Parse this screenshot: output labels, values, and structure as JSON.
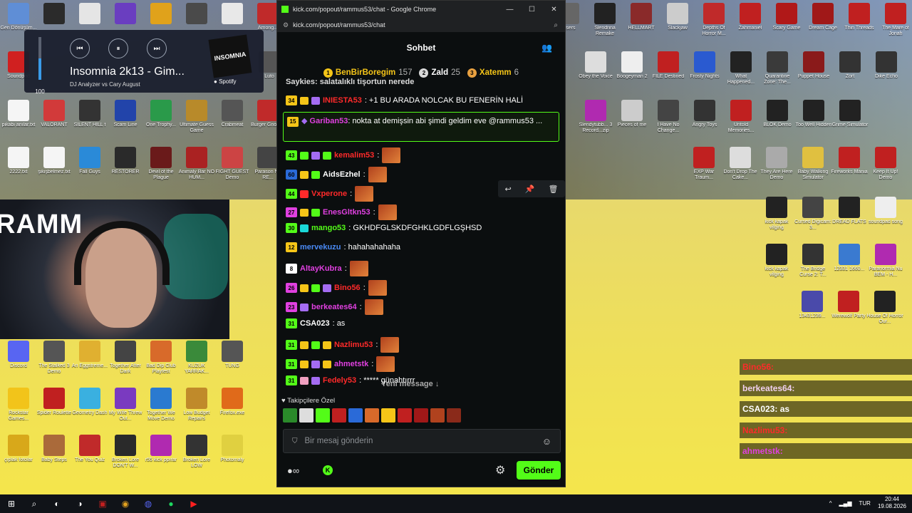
{
  "desktop": {
    "icons_left": [
      {
        "label": "Geri Dönüşüm...",
        "color": "#5f8ed6"
      },
      {
        "label": "",
        "color": "#2b2b2b"
      },
      {
        "label": "",
        "color": "#e5e5e5"
      },
      {
        "label": "",
        "color": "#6a3ec0"
      },
      {
        "label": "",
        "color": "#e0a21b"
      },
      {
        "label": "",
        "color": "#4a4a4a"
      },
      {
        "label": "",
        "color": "#e8e8e8"
      },
      {
        "label": "Among...",
        "color": "#c02a2a"
      }
    ],
    "icons_row2": [
      {
        "label": "Soundpad",
        "color": "#d02020"
      },
      {
        "label": "",
        "color": "#2a2a2a"
      },
      {
        "label": "",
        "color": "#3060b0"
      },
      {
        "label": "",
        "color": "#222"
      },
      {
        "label": "",
        "color": "#444"
      },
      {
        "label": "",
        "color": "#555"
      },
      {
        "label": "",
        "color": "#555"
      },
      {
        "label": "Luto",
        "color": "#555"
      }
    ],
    "icons_row3": [
      {
        "label": "pikabi anılar.txt",
        "color": "#f5f5f5"
      },
      {
        "label": "VALORANT",
        "color": "#d23a3a"
      },
      {
        "label": "SILENT HILL f",
        "color": "#333"
      },
      {
        "label": "Scam Line",
        "color": "#2244aa"
      },
      {
        "label": "One Trophy...",
        "color": "#2a9a4a"
      },
      {
        "label": "Ultimate Guess Game",
        "color": "#b88a2a"
      },
      {
        "label": "Crabmeat",
        "color": "#555"
      },
      {
        "label": "Burger Gnom...",
        "color": "#c02a2a"
      }
    ],
    "icons_row4": [
      {
        "label": "2222.txt",
        "color": "#f5f5f5"
      },
      {
        "label": "şikişbelmez.txt",
        "color": "#f5f5f5"
      },
      {
        "label": "Fall Guys",
        "color": "#2a8ad8"
      },
      {
        "label": "RESTORER",
        "color": "#2a2a2a"
      },
      {
        "label": "Devil of the Plague",
        "color": "#6a1a1a"
      },
      {
        "label": "Animaly Bar NO HUM...",
        "color": "#aa2222"
      },
      {
        "label": "FIGHT GUEST Demo",
        "color": "#cc4444"
      },
      {
        "label": "Parason No RE...",
        "color": "#444"
      }
    ],
    "icons_row7": [
      {
        "label": "Discord",
        "color": "#5865f2"
      },
      {
        "label": "The Stalked 3 Demo",
        "color": "#555"
      },
      {
        "label": "An Eggstreme...",
        "color": "#e0b030"
      },
      {
        "label": "Together After Dark",
        "color": "#444"
      },
      {
        "label": "Bad Dip Club Playtest",
        "color": "#d86a2a"
      },
      {
        "label": "KUZUK YARRAK...",
        "color": "#3a8a3a"
      },
      {
        "label": "TUNG",
        "color": "#555"
      }
    ],
    "icons_row8": [
      {
        "label": "Rockstar Games...",
        "color": "#f2c41a"
      },
      {
        "label": "Spider Roulette",
        "color": "#c02020"
      },
      {
        "label": "Geometry Dash",
        "color": "#3ab0e0"
      },
      {
        "label": "My Wife Threw Out...",
        "color": "#7a3ac0"
      },
      {
        "label": "Together We Move Demo",
        "color": "#2a7ad0"
      },
      {
        "label": "Low Budget Repairs",
        "color": "#c08a2a"
      },
      {
        "label": "Firefox.exe",
        "color": "#e06a1a"
      }
    ],
    "icons_row9": [
      {
        "label": "çıplak fotolar",
        "color": "#d8a81a"
      },
      {
        "label": "Baby Steps",
        "color": "#aa6a3a"
      },
      {
        "label": "The You Quiz",
        "color": "#c02a2a"
      },
      {
        "label": "Broken Lore DON'T W...",
        "color": "#2a2a2a"
      },
      {
        "label": "r55 kick ppırar",
        "color": "#b02ab0"
      },
      {
        "label": "Broken Lore LOW",
        "color": "#333"
      },
      {
        "label": "Photomaly",
        "color": "#e0d040"
      }
    ],
    "icons_right_r1": [
      {
        "label": "...sers",
        "color": "#666"
      },
      {
        "label": "Slendrina Remake",
        "color": "#222"
      },
      {
        "label": "HELLMART",
        "color": "#8a2a2a"
      },
      {
        "label": "Slackjaw",
        "color": "#ccc"
      },
      {
        "label": "Depths Of Horror M...",
        "color": "#c02a2a"
      },
      {
        "label": "Zahmaniel",
        "color": "#c02020"
      },
      {
        "label": "Scary Game",
        "color": "#b01818"
      },
      {
        "label": "Dream Cage",
        "color": "#a01818"
      },
      {
        "label": "Thin Threads",
        "color": "#c02020"
      },
      {
        "label": "The Mare of Jonah",
        "color": "#c02020"
      }
    ],
    "icons_right_r2": [
      {
        "label": "Obey the Voice",
        "color": "#ddd"
      },
      {
        "label": "Boogeyman 2",
        "color": "#eee"
      },
      {
        "label": "FILE Destined",
        "color": "#c02020"
      },
      {
        "label": "Frosty Nights",
        "color": "#2a5ad0"
      },
      {
        "label": "What Happened...",
        "color": "#222"
      },
      {
        "label": "Quarantine Zone: The...",
        "color": "#3a3a3a"
      },
      {
        "label": "Puppet House",
        "color": "#8a1a1a"
      },
      {
        "label": "Zort",
        "color": "#333"
      },
      {
        "label": "Dike Echo",
        "color": "#333"
      }
    ],
    "icons_right_r3": [
      {
        "label": "Slendytubb... 3 Record...zip",
        "color": "#b02ab0"
      },
      {
        "label": "Pieces of me",
        "color": "#ccc"
      },
      {
        "label": "I Have No Change...",
        "color": "#444"
      },
      {
        "label": "Angry Toys",
        "color": "#333"
      },
      {
        "label": "Untold Memories...",
        "color": "#c02020"
      },
      {
        "label": "BLOK Demo",
        "color": "#222"
      },
      {
        "label": "Too Well Hidden",
        "color": "#222"
      },
      {
        "label": "Grime Simulator",
        "color": "#222"
      }
    ],
    "icons_right_r4": [
      {
        "label": "EXP War Traum...",
        "color": "#c02020"
      },
      {
        "label": "Don't Drop The Cake...",
        "color": "#ddd"
      },
      {
        "label": "They Are Here Demo",
        "color": "#aaa"
      },
      {
        "label": "Baby Walking Simulator",
        "color": "#e0c040"
      },
      {
        "label": "Fireworks Mania",
        "color": "#c02020"
      },
      {
        "label": "Keep It Up! Demo",
        "color": "#c02020"
      }
    ],
    "icons_right_r5": [
      {
        "label": "kick kapak vilging",
        "color": "#222"
      },
      {
        "label": "Cursed Digicam: 3...",
        "color": "#444"
      },
      {
        "label": "DREAD FLATS",
        "color": "#222"
      },
      {
        "label": "soundpad song",
        "color": "#eee"
      }
    ],
    "icons_right_r6": [
      {
        "label": "kick kapak vilging",
        "color": "#222"
      },
      {
        "label": "The Bridge Curse 2: T...",
        "color": "#333"
      },
      {
        "label": "12331 1660...",
        "color": "#3a7ad0"
      },
      {
        "label": "Paranormia Nu BEM - H...",
        "color": "#b02ab0"
      }
    ],
    "icons_right_r7": [
      {
        "label": "13431239...",
        "color": "#4a4aaa"
      },
      {
        "label": "Werewolf Party",
        "color": "#c02020"
      },
      {
        "label": "House Of Horror Our...",
        "color": "#222"
      }
    ]
  },
  "media_widget": {
    "volume": "100",
    "volume_level": 0.5,
    "title": "Insomnia 2k13 - Gim...",
    "artist": "DJ Analyzer vs Cary August",
    "album_art_text": "INSOMNIA",
    "source": "Spotify"
  },
  "webcam": {
    "overlay_text": "RAMM"
  },
  "browser": {
    "title": "kick.com/popout/rammus53/chat - Google Chrome",
    "url": "kick.com/popout/rammus53/chat",
    "chat_title": "Sohbet"
  },
  "leaderboard": [
    {
      "rank": "1",
      "name": "BenBirBoregim",
      "count": "157",
      "color": "#f5c518",
      "rank_color": "#f5c518"
    },
    {
      "rank": "2",
      "name": "Zald",
      "count": "25",
      "color": "#ffffff",
      "rank_color": "#d9d9d9"
    },
    {
      "rank": "3",
      "name": "Xatemm",
      "count": "6",
      "color": "#f5c518",
      "rank_color": "#e8a040"
    }
  ],
  "chat": {
    "cut_message": "Saykies: salatalıklı tişortun nerede",
    "messages": [
      {
        "level": "34",
        "lvl_color": "#f5c518",
        "badges": [
          "#f5c518",
          "#a46cf2"
        ],
        "user": "INIESTA53",
        "user_color": "#ff2a2a",
        "text": ": +1 BU ARADA NOLCAK BU FENERİN HALİ",
        "emote": false
      },
      {
        "level": "43",
        "lvl_color": "#53fc18",
        "badges": [
          "#53fc18",
          "#a46cf2",
          "#53fc18"
        ],
        "user": "kemalim53",
        "user_color": "#ff2a2a",
        "text": ":",
        "emote": true
      },
      {
        "level": "60",
        "lvl_color": "#2a6ad8",
        "badges": [
          "#f5c518",
          "#53fc18"
        ],
        "user": "AidsEzhel",
        "user_color": "#ffffff",
        "text": ":",
        "emote": true
      },
      {
        "level": "44",
        "lvl_color": "#53fc18",
        "badges": [
          "#ff2a2a"
        ],
        "user": "Vxperone",
        "user_color": "#ff2a2a",
        "text": ":",
        "emote": true
      },
      {
        "level": "27",
        "lvl_color": "#e040e0",
        "badges": [
          "#f5c518",
          "#53fc18"
        ],
        "user": "EnesGltkn53",
        "user_color": "#e040e0",
        "text": ":",
        "emote": true
      },
      {
        "level": "30",
        "lvl_color": "#53fc18",
        "badges": [
          "#1ad8d8"
        ],
        "user": "mango53",
        "user_color": "#53fc18",
        "text": ": GKHDFGLSKDFGHKLGDFLGŞHSD",
        "emote": false
      },
      {
        "level": "12",
        "lvl_color": "#f5c518",
        "badges": [],
        "user": "mervekuzu",
        "user_color": "#4a8af5",
        "text": ": hahahahahaha",
        "emote": false
      },
      {
        "level": "8",
        "lvl_color": "#ffffff",
        "badges": [],
        "user": "AltayKubra",
        "user_color": "#e040e0",
        "text": ":",
        "emote": true
      },
      {
        "level": "26",
        "lvl_color": "#e040e0",
        "badges": [
          "#f5c518",
          "#53fc18",
          "#a46cf2"
        ],
        "user": "Bino56",
        "user_color": "#ff2a2a",
        "text": ":",
        "emote": true
      },
      {
        "level": "23",
        "lvl_color": "#e040e0",
        "badges": [
          "#a46cf2"
        ],
        "user": "berkeates64",
        "user_color": "#e040e0",
        "text": ":",
        "emote": true
      },
      {
        "level": "31",
        "lvl_color": "#53fc18",
        "badges": [],
        "user": "CSA023",
        "user_color": "#ffffff",
        "text": ": as",
        "emote": false
      },
      {
        "level": "31",
        "lvl_color": "#53fc18",
        "badges": [
          "#f5c518",
          "#53fc18",
          "#f5c518"
        ],
        "user": "Nazlimu53",
        "user_color": "#ff2a2a",
        "text": ":",
        "emote": true
      },
      {
        "level": "31",
        "lvl_color": "#53fc18",
        "badges": [
          "#f5c518",
          "#a46cf2",
          "#f5c518"
        ],
        "user": "ahmetstk",
        "user_color": "#e040e0",
        "text": ":",
        "emote": true
      },
      {
        "level": "31",
        "lvl_color": "#53fc18",
        "badges": [
          "#f0a0c0",
          "#a46cf2"
        ],
        "user": "Fedely53",
        "user_color": "#ff2a2a",
        "text": ": ***** günahtırrr",
        "emote": false
      }
    ],
    "highlight": {
      "level": "15",
      "user": "Gariban53",
      "text": ": nokta at demişsin abi şimdi geldim eve @rammus53 ..."
    },
    "new_message": "Yeni message ↓",
    "pinned_label": "Takipçilere Özel",
    "input_placeholder": "Bir mesaj gönderin",
    "send_label": "Gönder"
  },
  "overlay_chat": [
    {
      "user": "Bino56:",
      "color": "#ff2a2a",
      "text": ""
    },
    {
      "user": "berkeates64:",
      "color": "#f0d0f0",
      "text": ""
    },
    {
      "user": "CSA023: as",
      "color": "#ffffff",
      "text": ""
    },
    {
      "user": "Nazlimu53:",
      "color": "#ff2a2a",
      "text": ""
    },
    {
      "user": "ahmetstk:",
      "color": "#e040e0",
      "text": ""
    }
  ],
  "taskbar": {
    "language": "TUR",
    "time": "20:44",
    "date": "19.08.2026"
  }
}
